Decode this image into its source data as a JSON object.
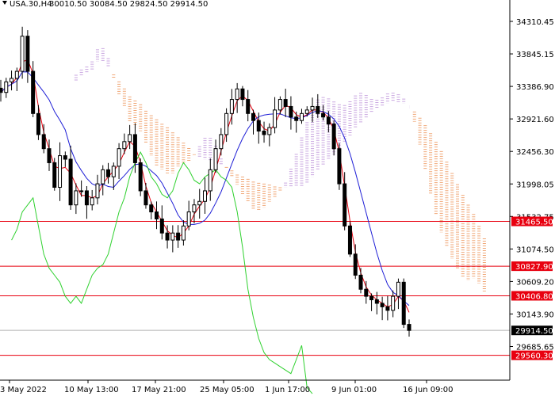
{
  "header": {
    "symbol_timeframe": "USA.30,H4",
    "ohlc": "30010.50 30084.50 29824.50 29914.50"
  },
  "colors": {
    "background": "#ffffff",
    "candle": "#000000",
    "tenkan": "#e8000f",
    "kijun": "#1f1fd6",
    "chikou": "#2fd12f",
    "cloud_up": "#c9a6e0",
    "cloud_down": "#f0a878",
    "level_line": "#e8000f",
    "current_line": "#b0b0b0",
    "tag_red": "#e8000f",
    "tag_black": "#000000"
  },
  "y_axis": {
    "ticks": [
      "34310.45",
      "33845.15",
      "33386.90",
      "32921.60",
      "32456.30",
      "31998.05",
      "31532.75",
      "31074.50",
      "30609.20",
      "30143.90",
      "29685.65"
    ]
  },
  "x_axis": {
    "ticks": [
      "3 May 2022",
      "10 May 13:00",
      "17 May 21:00",
      "25 May 05:00",
      "1 Jun 17:00",
      "9 Jun 01:00",
      "16 Jun 09:00"
    ]
  },
  "price_tags": [
    {
      "label": "31465.50",
      "kind": "level"
    },
    {
      "label": "30827.90",
      "kind": "level"
    },
    {
      "label": "30406.80",
      "kind": "level"
    },
    {
      "label": "29914.50",
      "kind": "current"
    },
    {
      "label": "29560.30",
      "kind": "level"
    }
  ],
  "chart_data": {
    "type": "line",
    "title": "USA.30,H4",
    "ylim": [
      29560,
      34400
    ],
    "levels": [
      31465.5,
      30827.9,
      30406.8,
      29560.3
    ],
    "current_price": 29914.5,
    "close_series": [
      33300,
      33450,
      33500,
      33600,
      34100,
      33600,
      33000,
      32700,
      32500,
      32300,
      31950,
      32400,
      32350,
      31700,
      31900,
      31900,
      31700,
      31800,
      32000,
      32200,
      32100,
      32250,
      32500,
      32600,
      32700,
      32300,
      31900,
      31700,
      31600,
      31500,
      31300,
      31200,
      31300,
      31200,
      31400,
      31600,
      31700,
      31750,
      31900,
      32200,
      32500,
      32700,
      33000,
      33200,
      33350,
      33200,
      33000,
      32900,
      32750,
      32700,
      32800,
      33050,
      33200,
      33100,
      32950,
      32900,
      33000,
      33050,
      33100,
      33000,
      32950,
      32850,
      32500,
      32000,
      31400,
      31000,
      30700,
      30500,
      30400,
      30350,
      30300,
      30250,
      30200,
      30400,
      30600,
      30000,
      29914.5
    ]
  }
}
